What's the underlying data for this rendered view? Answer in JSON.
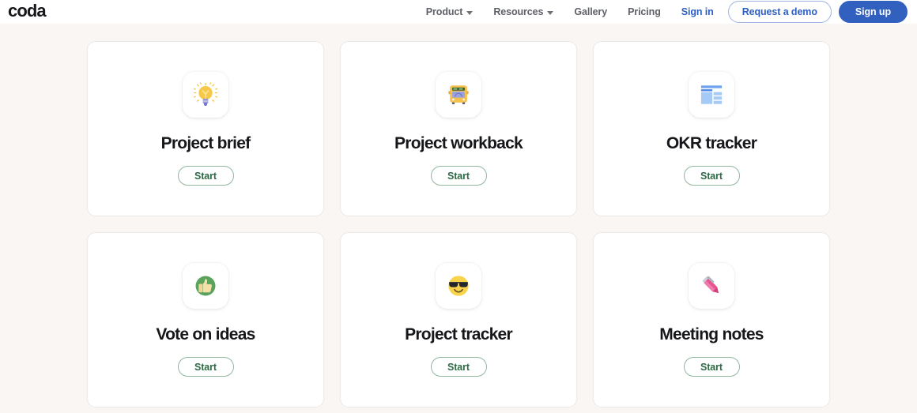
{
  "header": {
    "brand": "coda",
    "nav": [
      {
        "label": "Product",
        "caret": true,
        "style": "muted",
        "icon": "chevron-down-icon"
      },
      {
        "label": "Resources",
        "caret": true,
        "style": "muted",
        "icon": "chevron-down-icon"
      },
      {
        "label": "Gallery",
        "caret": false,
        "style": "muted"
      },
      {
        "label": "Pricing",
        "caret": false,
        "style": "muted"
      },
      {
        "label": "Sign in",
        "caret": false,
        "style": "link"
      }
    ],
    "demo_button": "Request a demo",
    "signup_button": "Sign up"
  },
  "colors": {
    "page_background": "#faf6f3",
    "card_background": "#ffffff",
    "card_border": "#ebe9e7",
    "brand_blue": "#3160bf",
    "link_blue": "#2f5fc4",
    "start_green_text": "#2d6a45",
    "start_green_border": "#8fb79c",
    "title_text": "#16171a",
    "nav_text": "#5d6066"
  },
  "cards": [
    {
      "title": "Project brief",
      "icon": "lightbulb-icon",
      "button": "Start"
    },
    {
      "title": "Project workback",
      "icon": "bus-icon",
      "button": "Start"
    },
    {
      "title": "OKR tracker",
      "icon": "page-layout-icon",
      "button": "Start"
    },
    {
      "title": "Vote on ideas",
      "icon": "thumbs-up-icon",
      "button": "Start"
    },
    {
      "title": "Project tracker",
      "icon": "sunglasses-face-icon",
      "button": "Start"
    },
    {
      "title": "Meeting notes",
      "icon": "pen-icon",
      "button": "Start"
    }
  ]
}
